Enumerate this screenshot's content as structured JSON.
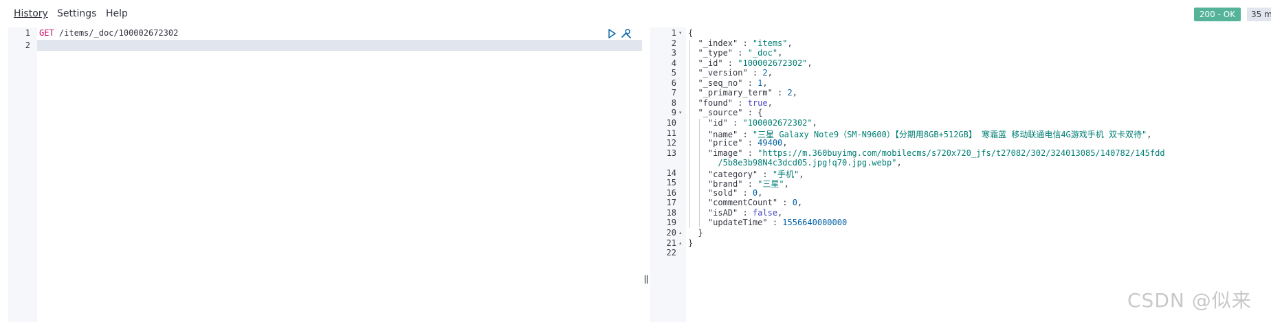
{
  "menu": {
    "history": "History",
    "settings": "Settings",
    "help": "Help"
  },
  "status": {
    "code": "200 - OK",
    "time": "35 m"
  },
  "request": {
    "line_numbers": [
      "1",
      "2"
    ],
    "method": "GET",
    "path": "/items/_doc/100002672302"
  },
  "response": {
    "line_numbers": [
      "1",
      "2",
      "3",
      "4",
      "5",
      "6",
      "7",
      "8",
      "9",
      "10",
      "11",
      "12",
      "13",
      "14",
      "15",
      "16",
      "17",
      "18",
      "19",
      "20",
      "21",
      "22"
    ],
    "lines": [
      [
        {
          "t": "p",
          "v": "{"
        }
      ],
      [
        {
          "t": "k",
          "v": "  \"_index\" : "
        },
        {
          "t": "s",
          "v": "\"items\""
        },
        {
          "t": "p",
          "v": ","
        }
      ],
      [
        {
          "t": "k",
          "v": "  \"_type\" : "
        },
        {
          "t": "s",
          "v": "\"_doc\""
        },
        {
          "t": "p",
          "v": ","
        }
      ],
      [
        {
          "t": "k",
          "v": "  \"_id\" : "
        },
        {
          "t": "s",
          "v": "\"100002672302\""
        },
        {
          "t": "p",
          "v": ","
        }
      ],
      [
        {
          "t": "k",
          "v": "  \"_version\" : "
        },
        {
          "t": "n",
          "v": "2"
        },
        {
          "t": "p",
          "v": ","
        }
      ],
      [
        {
          "t": "k",
          "v": "  \"_seq_no\" : "
        },
        {
          "t": "n",
          "v": "1"
        },
        {
          "t": "p",
          "v": ","
        }
      ],
      [
        {
          "t": "k",
          "v": "  \"_primary_term\" : "
        },
        {
          "t": "n",
          "v": "2"
        },
        {
          "t": "p",
          "v": ","
        }
      ],
      [
        {
          "t": "k",
          "v": "  \"found\" : "
        },
        {
          "t": "b",
          "v": "true"
        },
        {
          "t": "p",
          "v": ","
        }
      ],
      [
        {
          "t": "k",
          "v": "  \"_source\" : {"
        }
      ],
      [
        {
          "t": "k",
          "v": "    \"id\" : "
        },
        {
          "t": "s",
          "v": "\"100002672302\""
        },
        {
          "t": "p",
          "v": ","
        }
      ],
      [
        {
          "t": "k",
          "v": "    \"name\" : "
        },
        {
          "t": "s",
          "v": "\"三星 Galaxy Note9（SM-N9600）【分期用8GB+512GB】 寒霜蓝 移动联通电信4G游戏手机 双卡双待\""
        },
        {
          "t": "p",
          "v": ","
        }
      ],
      [
        {
          "t": "k",
          "v": "    \"price\" : "
        },
        {
          "t": "n",
          "v": "49400"
        },
        {
          "t": "p",
          "v": ","
        }
      ],
      [
        {
          "t": "k",
          "v": "    \"image\" : "
        },
        {
          "t": "s",
          "v": "\"https://m.360buyimg.com/mobilecms/s720x720_jfs/t27082/302/324013085/140782/145fdd"
        }
      ],
      [
        {
          "t": "s",
          "v": "      /5b8e3b98N4c3dcd05.jpg!q70.jpg.webp\""
        },
        {
          "t": "p",
          "v": ","
        }
      ],
      [
        {
          "t": "k",
          "v": "    \"category\" : "
        },
        {
          "t": "s",
          "v": "\"手机\""
        },
        {
          "t": "p",
          "v": ","
        }
      ],
      [
        {
          "t": "k",
          "v": "    \"brand\" : "
        },
        {
          "t": "s",
          "v": "\"三星\""
        },
        {
          "t": "p",
          "v": ","
        }
      ],
      [
        {
          "t": "k",
          "v": "    \"sold\" : "
        },
        {
          "t": "n",
          "v": "0"
        },
        {
          "t": "p",
          "v": ","
        }
      ],
      [
        {
          "t": "k",
          "v": "    \"commentCount\" : "
        },
        {
          "t": "n",
          "v": "0"
        },
        {
          "t": "p",
          "v": ","
        }
      ],
      [
        {
          "t": "k",
          "v": "    \"isAD\" : "
        },
        {
          "t": "b",
          "v": "false"
        },
        {
          "t": "p",
          "v": ","
        }
      ],
      [
        {
          "t": "k",
          "v": "    \"updateTime\" : "
        },
        {
          "t": "n",
          "v": "1556640000000"
        }
      ],
      [
        {
          "t": "p",
          "v": "  }"
        }
      ],
      [
        {
          "t": "p",
          "v": "}"
        }
      ],
      [
        {
          "t": "p",
          "v": ""
        }
      ]
    ],
    "line_label_index": [
      0,
      1,
      2,
      3,
      4,
      5,
      6,
      7,
      8,
      9,
      10,
      11,
      12,
      null,
      13,
      14,
      15,
      16,
      17,
      18,
      19,
      20,
      21
    ],
    "fold_lines": [
      "1",
      "9",
      "20",
      "21"
    ]
  },
  "watermark": "CSDN @似来",
  "colors": {
    "status_ok": "#54b399",
    "method": "#c80a68",
    "string": "#017d73",
    "number": "#0061a6",
    "boolean": "#4a4ac4"
  }
}
